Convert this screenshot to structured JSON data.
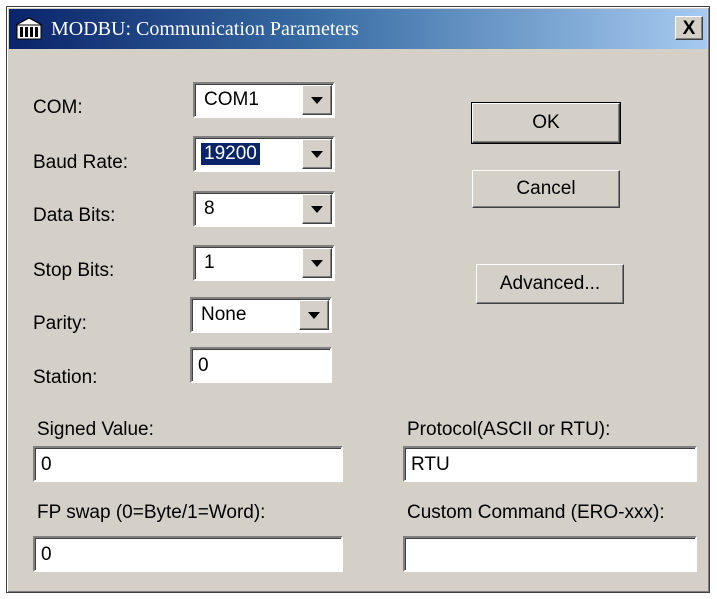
{
  "window": {
    "title": "MODBU: Communication Parameters",
    "close_label": "X"
  },
  "fields": {
    "com": {
      "label": "COM:",
      "value": "COM1"
    },
    "baud_rate": {
      "label": "Baud Rate:",
      "value": "19200"
    },
    "data_bits": {
      "label": "Data Bits:",
      "value": "8"
    },
    "stop_bits": {
      "label": "Stop Bits:",
      "value": "1"
    },
    "parity": {
      "label": "Parity:",
      "value": "None"
    },
    "station": {
      "label": "Station:",
      "value": "0"
    },
    "signed_value": {
      "label": "Signed Value:",
      "value": "0"
    },
    "fp_swap": {
      "label": "FP swap (0=Byte/1=Word):",
      "value": "0"
    },
    "protocol": {
      "label": "Protocol(ASCII or RTU):",
      "value": "RTU"
    },
    "custom_command": {
      "label": "Custom Command (ERO-xxx):",
      "value": ""
    }
  },
  "buttons": {
    "ok": "OK",
    "cancel": "Cancel",
    "advanced": "Advanced..."
  },
  "icons": {
    "app": "app-icon",
    "close": "close-icon",
    "dropdown": "chevron-down-icon"
  },
  "colors": {
    "title_gradient_start": "#0a246a",
    "title_gradient_end": "#a6caf0",
    "dialog_face": "#d4d0c8",
    "selection": "#0a246a"
  }
}
